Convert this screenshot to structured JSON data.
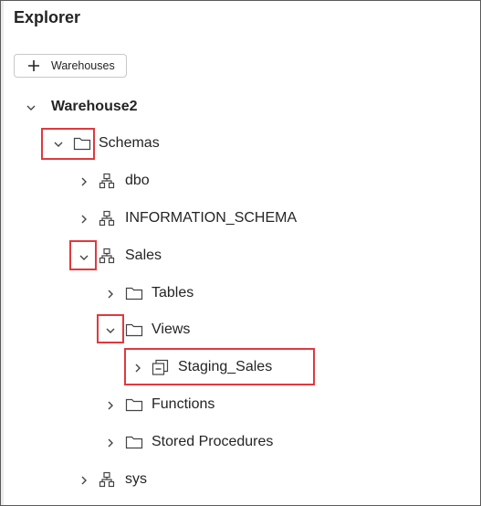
{
  "panel": {
    "title": "Explorer"
  },
  "toolbar": {
    "add_label": "Warehouses",
    "add_icon": "plus-icon"
  },
  "tree": {
    "warehouse": "Warehouse2",
    "schemas": "Schemas",
    "dbo": "dbo",
    "information_schema": "INFORMATION_SCHEMA",
    "sales": "Sales",
    "tables": "Tables",
    "views": "Views",
    "staging_sales": "Staging_Sales",
    "functions": "Functions",
    "stored_procedures": "Stored Procedures",
    "sys": "sys"
  },
  "colors": {
    "highlight": "#e0393e",
    "text": "#242424"
  }
}
